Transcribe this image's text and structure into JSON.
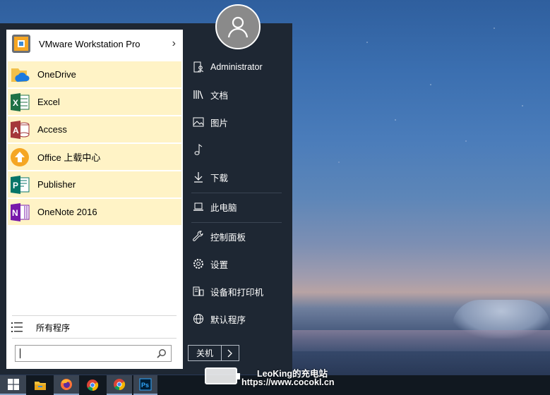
{
  "left_panel": {
    "pinned_app": {
      "label": "VMware Workstation Pro",
      "icon": "vmware-icon"
    },
    "apps": [
      {
        "label": "OneDrive",
        "icon": "onedrive-icon"
      },
      {
        "label": "Excel",
        "icon": "excel-icon"
      },
      {
        "label": "Access",
        "icon": "access-icon"
      },
      {
        "label": "Office 上载中心",
        "icon": "office-upload-icon"
      },
      {
        "label": "Publisher",
        "icon": "publisher-icon"
      },
      {
        "label": "OneNote 2016",
        "icon": "onenote-icon"
      }
    ],
    "all_programs": "所有程序",
    "search": {
      "value": "",
      "placeholder": ""
    }
  },
  "right_panel": {
    "items": [
      {
        "label": "Administrator",
        "icon": "user-folder-icon"
      },
      {
        "label": "文档",
        "icon": "library-icon"
      },
      {
        "label": "图片",
        "icon": "picture-icon"
      },
      {
        "label": "",
        "icon": "music-note-icon"
      },
      {
        "label": "下载",
        "icon": "download-icon"
      },
      {
        "label": "此电脑",
        "icon": "laptop-icon"
      },
      {
        "label": "控制面板",
        "icon": "wrench-icon"
      },
      {
        "label": "设置",
        "icon": "gear-icon"
      },
      {
        "label": "设备和打印机",
        "icon": "devices-icon"
      },
      {
        "label": "默认程序",
        "icon": "globe-icon"
      }
    ],
    "shutdown_label": "关机"
  },
  "taskbar": {
    "items": [
      "windows-start-icon",
      "file-explorer-icon",
      "firefox-icon",
      "chrome-icon",
      "chrome-icon",
      "photoshop-icon"
    ]
  },
  "watermark": {
    "line1": "LeoKing的充电站",
    "line2": "https://www.cocokl.cn"
  },
  "colors": {
    "menu_bg": "#1e2733",
    "highlight": "#fff3c6",
    "taskbar_bg": "#111820"
  }
}
